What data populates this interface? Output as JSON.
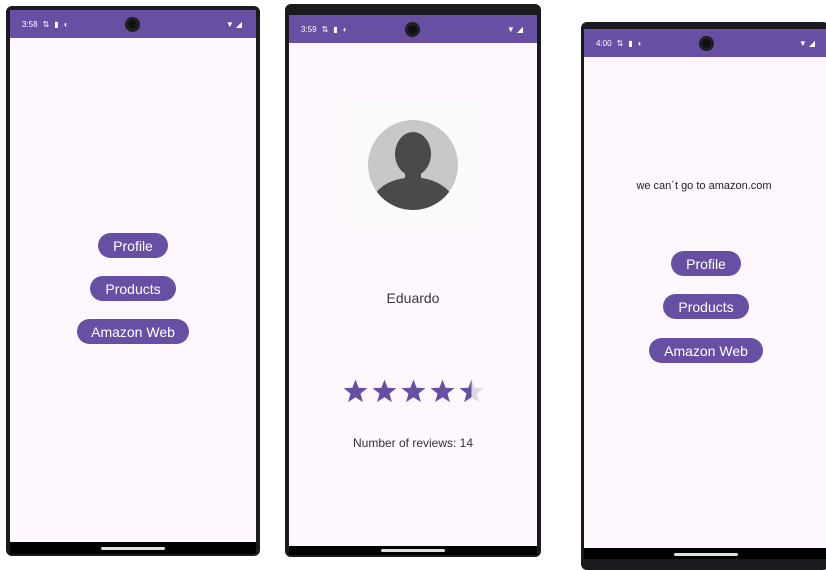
{
  "colors": {
    "primary": "#6750a4",
    "screen_bg": "#fef7fd",
    "star_empty": "#dcd6e8",
    "avatar_bg": "#c8c8c8",
    "avatar_fg": "#4a4a4a"
  },
  "screens": [
    {
      "status": {
        "time": "3:58"
      },
      "buttons": {
        "profile": "Profile",
        "products": "Products",
        "amazon": "Amazon Web"
      }
    },
    {
      "status": {
        "time": "3:59"
      },
      "profile": {
        "name": "Eduardo",
        "rating": 4.5,
        "rating_max": 5,
        "reviews_text": "Number of reviews: 14"
      }
    },
    {
      "status": {
        "time": "4:00"
      },
      "message": "we can´t go to amazon.com",
      "buttons": {
        "profile": "Profile",
        "products": "Products",
        "amazon": "Amazon Web"
      }
    }
  ]
}
